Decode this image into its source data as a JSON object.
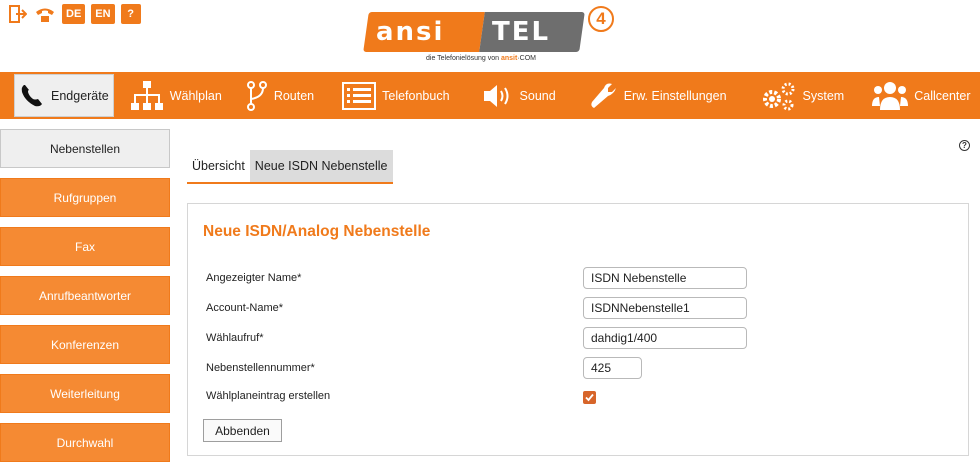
{
  "quick_icons": [
    {
      "name": "logout-icon",
      "label": ""
    },
    {
      "name": "phone-hangup-icon",
      "label": ""
    },
    {
      "name": "lang-de",
      "label": "DE"
    },
    {
      "name": "lang-en",
      "label": "EN"
    },
    {
      "name": "help-button",
      "label": "?"
    }
  ],
  "logo": {
    "left": "ansi",
    "right": "TEL",
    "badge": "4",
    "tagline_prefix": "die Telefonielösung von ",
    "tagline_brand": "ansit",
    "tagline_suffix": "·COM"
  },
  "nav": {
    "items": [
      {
        "label": "Endgeräte",
        "icon": "phone-icon"
      },
      {
        "label": "Wählplan",
        "icon": "sitemap-icon"
      },
      {
        "label": "Routen",
        "icon": "route-icon"
      },
      {
        "label": "Telefonbuch",
        "icon": "list-icon"
      },
      {
        "label": "Sound",
        "icon": "speaker-icon"
      },
      {
        "label": "Erw. Einstellungen",
        "icon": "wrench-icon"
      },
      {
        "label": "System",
        "icon": "gears-icon"
      },
      {
        "label": "Callcenter",
        "icon": "users-icon"
      }
    ]
  },
  "sidebar": {
    "items": [
      {
        "label": "Nebenstellen"
      },
      {
        "label": "Rufgruppen"
      },
      {
        "label": "Fax"
      },
      {
        "label": "Anrufbeantworter"
      },
      {
        "label": "Konferenzen"
      },
      {
        "label": "Weiterleitung"
      },
      {
        "label": "Durchwahl"
      }
    ]
  },
  "help": {
    "label": "?"
  },
  "tabs": [
    {
      "label": "Übersicht"
    },
    {
      "label": "Neue ISDN Nebenstelle"
    }
  ],
  "form": {
    "title": "Neue ISDN/Analog Nebenstelle",
    "fields": [
      {
        "label": "Angezeigter Name*",
        "value": "ISDN Nebenstelle"
      },
      {
        "label": "Account-Name*",
        "value": "ISDNNebenstelle1"
      },
      {
        "label": "Wählaufruf*",
        "value": "dahdig1/400"
      },
      {
        "label": "Nebenstellennummer*",
        "value": "425"
      }
    ],
    "checkbox_label": "Wählplaneintrag erstellen",
    "checkbox_checked": true,
    "cancel_label": "Abbenden"
  },
  "colors": {
    "accent": "#f07a1b",
    "sidebar": "#f58a33",
    "logo_grey": "#6e6e6e"
  }
}
